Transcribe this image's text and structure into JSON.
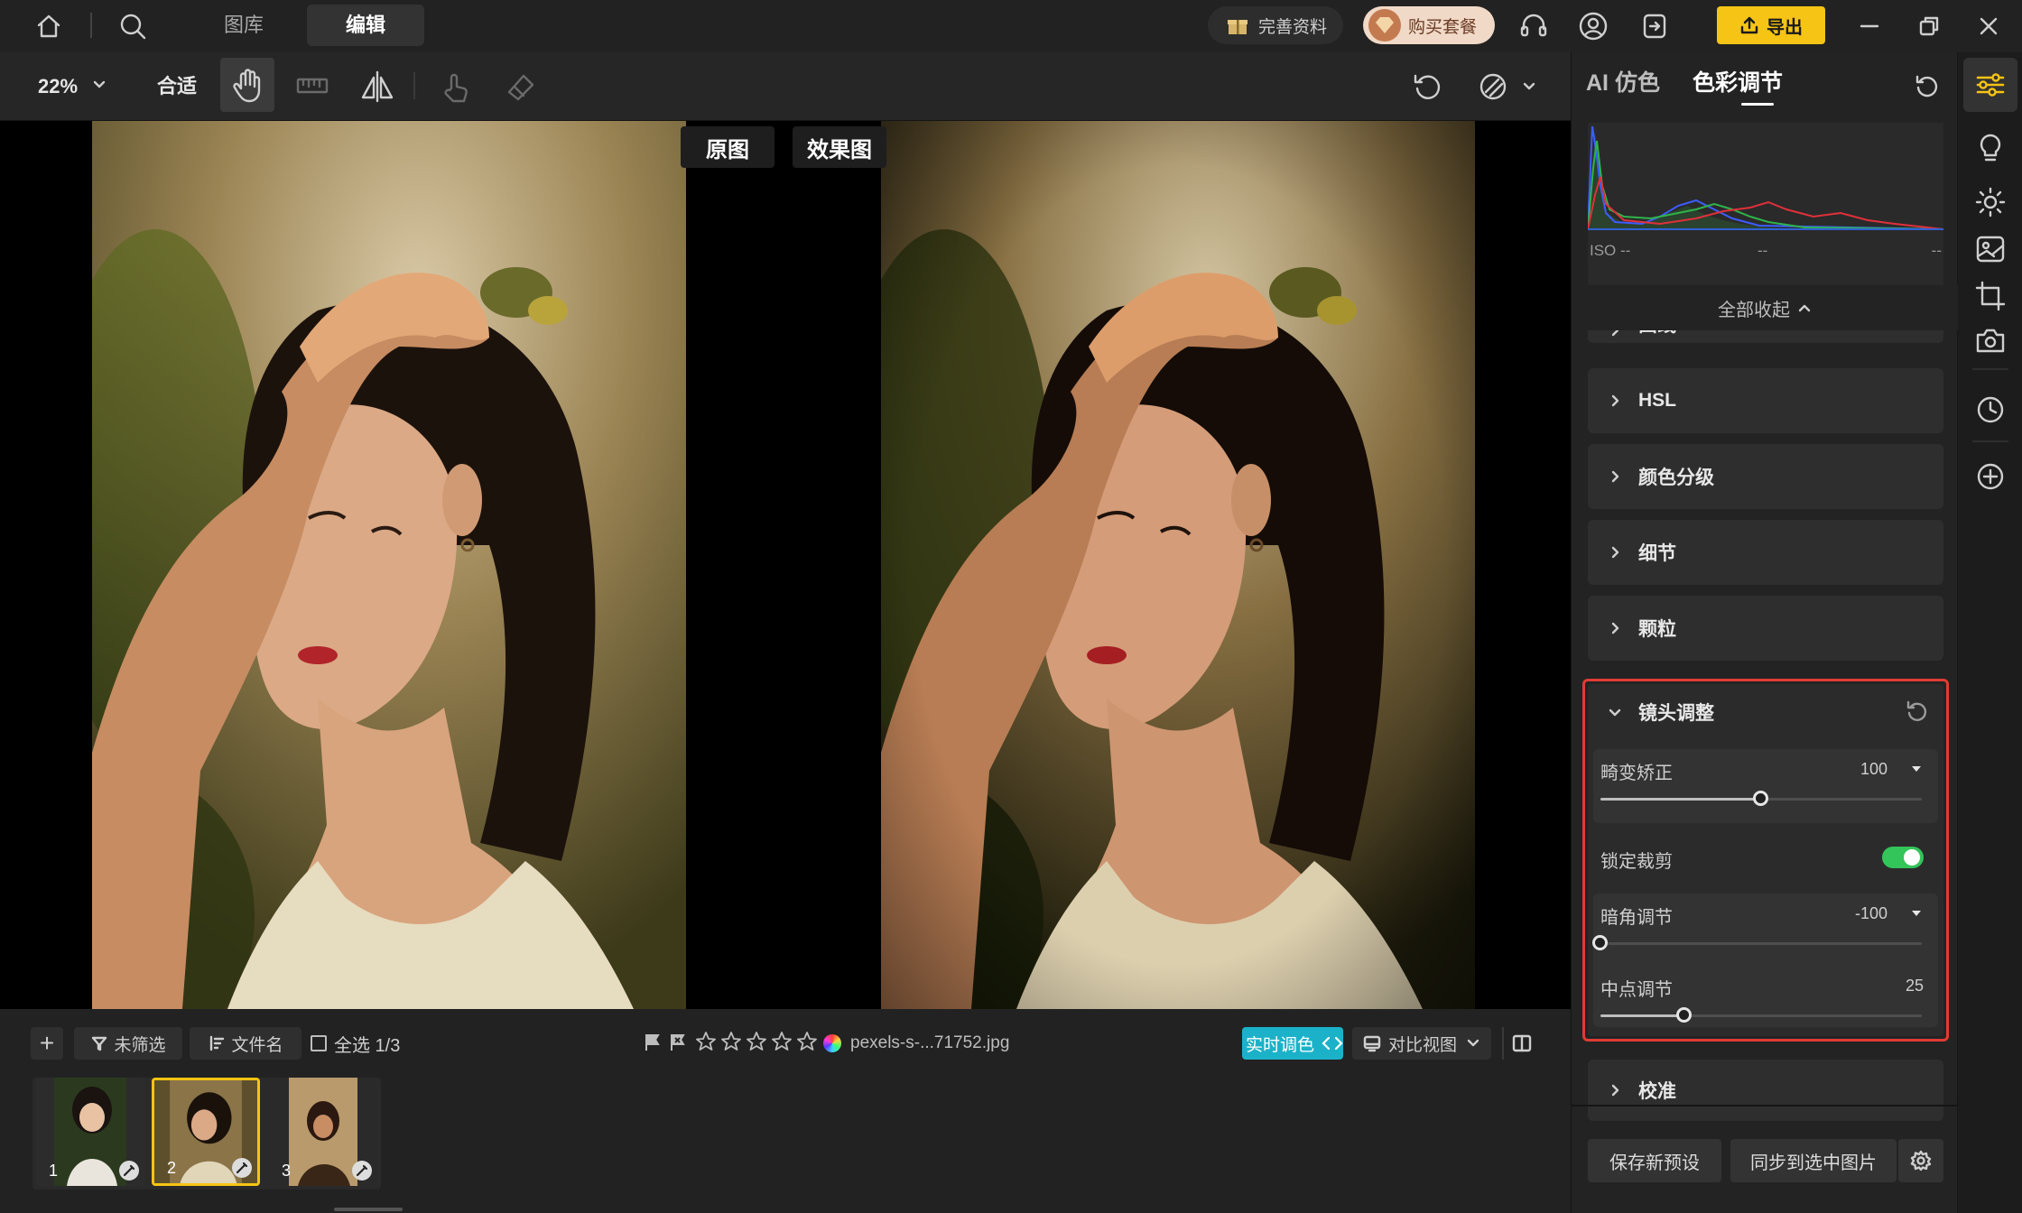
{
  "topbar": {
    "tabs": [
      {
        "label": "图库"
      },
      {
        "label": "编辑"
      }
    ],
    "complete_profile": "完善资料",
    "buy_plan": "购买套餐",
    "export": "导出"
  },
  "toolbar": {
    "zoom": "22%",
    "fit": "合适"
  },
  "canvas": {
    "original_label": "原图",
    "result_label": "效果图"
  },
  "bottom": {
    "add": "+",
    "filter": "未筛选",
    "sort": "文件名",
    "select_all": "全选 1/3",
    "filename": "pexels-s-...71752.jpg",
    "realtime": "实时调色",
    "compare_view": "对比视图",
    "thumbnails": [
      {
        "num": "1"
      },
      {
        "num": "2"
      },
      {
        "num": "3"
      }
    ]
  },
  "panel": {
    "tabs": [
      {
        "label": "AI 仿色"
      },
      {
        "label": "色彩调节"
      }
    ],
    "histogram": {
      "iso": "ISO --",
      "mid": "--",
      "right": "--"
    },
    "collapse_all": "全部收起",
    "sections": {
      "curve": "曲线",
      "hsl": "HSL",
      "color_grading": "颜色分级",
      "detail": "细节",
      "grain": "颗粒",
      "lens": "镜头调整",
      "calibration": "校准"
    },
    "lens": {
      "distortion": {
        "label": "畸变矫正",
        "value": "100",
        "fill": 0.5
      },
      "lock_crop": {
        "label": "锁定裁剪",
        "on": true
      },
      "vignette": {
        "label": "暗角调节",
        "value": "-100",
        "fill": 0.0
      },
      "midpoint": {
        "label": "中点调节",
        "value": "25",
        "fill": 0.26
      }
    },
    "save_preset": "保存新预设",
    "sync_selected": "同步到选中图片"
  },
  "colors": {
    "accent_yellow": "#f6c414",
    "toggle_green": "#33c45a",
    "highlight_red": "#e03b35",
    "realtime_cyan": "#1bb2c9"
  }
}
